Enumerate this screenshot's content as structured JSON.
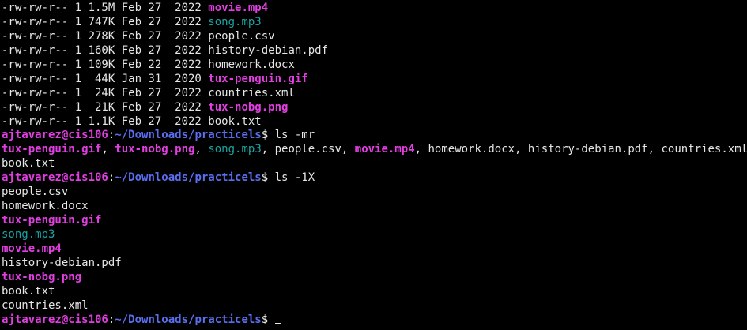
{
  "colors": {
    "background": "#000000",
    "text": "#e6e6e6",
    "video": "#e23ee2",
    "image": "#e23ee2",
    "audio": "#1aa3a3",
    "user": "#e23ee2",
    "path": "#5a6ff0"
  },
  "long_listing": [
    {
      "perms": "-rw-rw-r--",
      "links": "1",
      "size": "1.5M",
      "month": "Feb",
      "day": "27",
      "year": "2022",
      "name": "movie.mp4",
      "kind": "video"
    },
    {
      "perms": "-rw-rw-r--",
      "links": "1",
      "size": "747K",
      "month": "Feb",
      "day": "27",
      "year": "2022",
      "name": "song.mp3",
      "kind": "audio"
    },
    {
      "perms": "-rw-rw-r--",
      "links": "1",
      "size": "278K",
      "month": "Feb",
      "day": "27",
      "year": "2022",
      "name": "people.csv",
      "kind": "default"
    },
    {
      "perms": "-rw-rw-r--",
      "links": "1",
      "size": "160K",
      "month": "Feb",
      "day": "27",
      "year": "2022",
      "name": "history-debian.pdf",
      "kind": "default"
    },
    {
      "perms": "-rw-rw-r--",
      "links": "1",
      "size": "109K",
      "month": "Feb",
      "day": "22",
      "year": "2022",
      "name": "homework.docx",
      "kind": "default"
    },
    {
      "perms": "-rw-rw-r--",
      "links": "1",
      "size": " 44K",
      "month": "Jan",
      "day": "31",
      "year": "2020",
      "name": "tux-penguin.gif",
      "kind": "image"
    },
    {
      "perms": "-rw-rw-r--",
      "links": "1",
      "size": " 24K",
      "month": "Feb",
      "day": "27",
      "year": "2022",
      "name": "countries.xml",
      "kind": "default"
    },
    {
      "perms": "-rw-rw-r--",
      "links": "1",
      "size": " 21K",
      "month": "Feb",
      "day": "27",
      "year": "2022",
      "name": "tux-nobg.png",
      "kind": "image"
    },
    {
      "perms": "-rw-rw-r--",
      "links": "1",
      "size": "1.1K",
      "month": "Feb",
      "day": "27",
      "year": "2022",
      "name": "book.txt",
      "kind": "default"
    }
  ],
  "prompt": {
    "user_host": "ajtavarez@cis106",
    "colon": ":",
    "path": "~/Downloads/practicels",
    "symbol": "$ "
  },
  "commands": [
    {
      "text": "ls -mr"
    },
    {
      "text": "ls -1X"
    },
    {
      "text": ""
    }
  ],
  "comma_listing": {
    "items": [
      {
        "name": "tux-penguin.gif",
        "kind": "image"
      },
      {
        "name": "tux-nobg.png",
        "kind": "image"
      },
      {
        "name": "song.mp3",
        "kind": "audio"
      },
      {
        "name": "people.csv",
        "kind": "default"
      },
      {
        "name": "movie.mp4",
        "kind": "video"
      },
      {
        "name": "homework.docx",
        "kind": "default"
      },
      {
        "name": "history-debian.pdf",
        "kind": "default"
      },
      {
        "name": "countries.xml",
        "kind": "default"
      }
    ],
    "separator": ", ",
    "wrapped_last": {
      "name": "book.txt",
      "kind": "default"
    }
  },
  "one_per_line": [
    {
      "name": "people.csv",
      "kind": "default"
    },
    {
      "name": "homework.docx",
      "kind": "default"
    },
    {
      "name": "tux-penguin.gif",
      "kind": "image"
    },
    {
      "name": "song.mp3",
      "kind": "audio"
    },
    {
      "name": "movie.mp4",
      "kind": "video"
    },
    {
      "name": "history-debian.pdf",
      "kind": "default"
    },
    {
      "name": "tux-nobg.png",
      "kind": "image"
    },
    {
      "name": "book.txt",
      "kind": "default"
    },
    {
      "name": "countries.xml",
      "kind": "default"
    }
  ]
}
